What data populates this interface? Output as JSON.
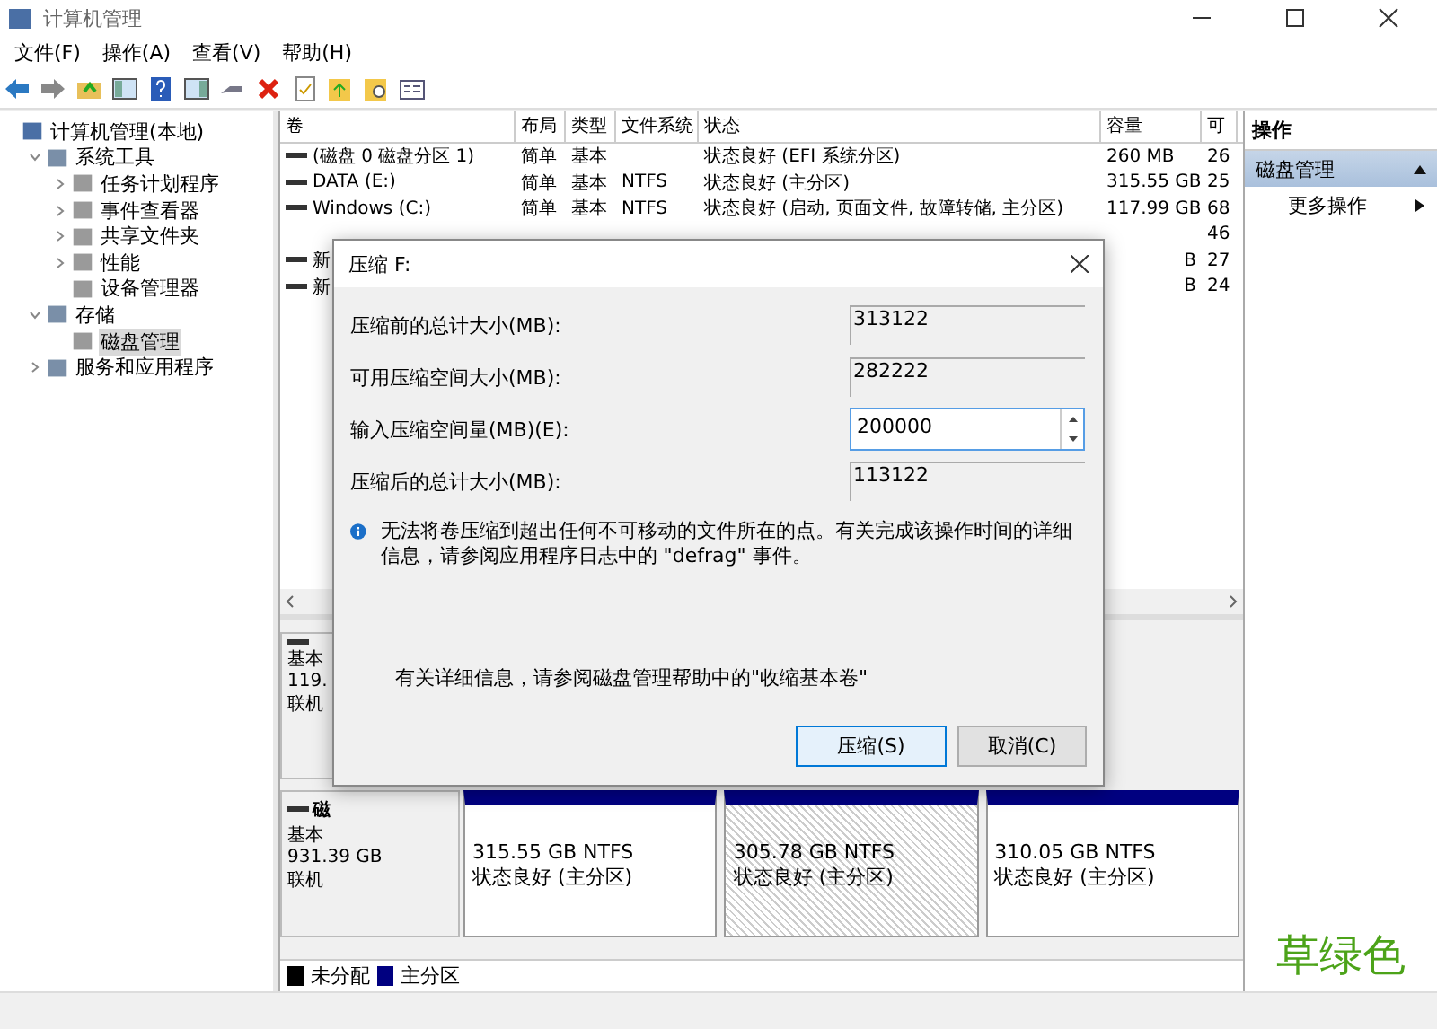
{
  "window": {
    "title": "计算机管理"
  },
  "menu": [
    "文件(F)",
    "操作(A)",
    "查看(V)",
    "帮助(H)"
  ],
  "tree": [
    {
      "label": "计算机管理(本地)",
      "selected": false,
      "children": [
        {
          "label": "系统工具",
          "selected": false,
          "expanded": true,
          "children": [
            {
              "label": "任务计划程序",
              "selected": false,
              "expanded": false
            },
            {
              "label": "事件查看器",
              "selected": false,
              "expanded": false
            },
            {
              "label": "共享文件夹",
              "selected": false,
              "expanded": false
            },
            {
              "label": "性能",
              "selected": false,
              "expanded": false
            },
            {
              "label": "设备管理器",
              "selected": false
            }
          ]
        },
        {
          "label": "存储",
          "selected": false,
          "expanded": true,
          "children": [
            {
              "label": "磁盘管理",
              "selected": true
            }
          ]
        },
        {
          "label": "服务和应用程序",
          "selected": false,
          "expanded": false
        }
      ]
    }
  ],
  "table": {
    "columns": [
      "卷",
      "布局",
      "类型",
      "文件系统",
      "状态",
      "容量",
      "可"
    ],
    "rows": [
      {
        "volume": "(磁盘 0 磁盘分区 1)",
        "layout": "简单",
        "type": "基本",
        "status": "状态良好 (EFI 系统分区)",
        "capacity": "260 MB",
        "column_7": "26"
      },
      {
        "volume": "DATA (E:)",
        "layout": "简单",
        "type": "基本",
        "fs": "NTFS",
        "status": "状态良好 (主分区)",
        "capacity": "315.55 GB",
        "column_7": "25"
      },
      {
        "volume": "Windows (C:)",
        "layout": "简单",
        "type": "基本",
        "fs": "NTFS",
        "status": "状态良好 (启动, 页面文件, 故障转储, 主分区)",
        "capacity": "117.99 GB",
        "column_7": "68"
      },
      {
        "column_7": "46"
      },
      {
        "volume": "新",
        "capacity": "B",
        "column_7": "27"
      },
      {
        "volume": "新",
        "capacity": "B",
        "column_7": "24"
      }
    ]
  },
  "disks": [
    {
      "type": "基本",
      "size": "119.",
      "status": "联机"
    },
    {
      "title": "磁",
      "type": "基本",
      "size": "931.39 GB",
      "status": "联机",
      "partitions": [
        {
          "size": "315.55 GB NTFS",
          "status": "状态良好 (主分区)",
          "selected": false
        },
        {
          "size": "305.78 GB NTFS",
          "status": "状态良好 (主分区)",
          "selected": true
        },
        {
          "size": "310.05 GB NTFS",
          "status": "状态良好 (主分区)",
          "selected": false
        }
      ]
    }
  ],
  "legend": [
    {
      "label": "未分配",
      "color": "#000000"
    },
    {
      "label": "主分区",
      "color": "#000080"
    }
  ],
  "actions": {
    "title": "操作",
    "items": [
      {
        "label": "磁盘管理",
        "kind": "header"
      },
      {
        "label": "更多操作",
        "kind": "item"
      }
    ]
  },
  "dialog": {
    "title": "压缩 F:",
    "fields": [
      {
        "label": "压缩前的总计大小(MB):",
        "value": "313122",
        "kind": "readonly"
      },
      {
        "label": "可用压缩空间大小(MB):",
        "value": "282222",
        "kind": "readonly"
      },
      {
        "label": "输入压缩空间量(MB)(E):",
        "value": "200000",
        "kind": "spin"
      },
      {
        "label": "压缩后的总计大小(MB):",
        "value": "113122",
        "kind": "readonly"
      }
    ],
    "info": "无法将卷压缩到超出任何不可移动的文件所在的点。有关完成该操作时间的详细信息，请参阅应用程序日志中的 \"defrag\" 事件。",
    "help": "有关详细信息，请参阅磁盘管理帮助中的\"收缩基本卷\"",
    "buttons": [
      {
        "label": "压缩(S)",
        "default": true
      },
      {
        "label": "取消(C)",
        "default": false
      }
    ]
  },
  "annotation": "草绿色"
}
